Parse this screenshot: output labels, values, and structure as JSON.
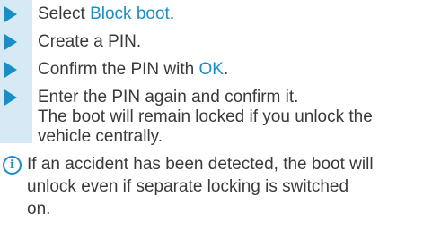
{
  "steps": [
    {
      "prefix": "Select ",
      "highlight": "Block boot",
      "suffix": "."
    },
    {
      "prefix": "Create a PIN.",
      "highlight": "",
      "suffix": ""
    },
    {
      "prefix": "Confirm the PIN with ",
      "highlight": "OK",
      "suffix": "."
    },
    {
      "lines": [
        "Enter the PIN again and confirm it.",
        "The boot will remain locked if you unlock the",
        "vehicle centrally."
      ]
    }
  ],
  "info_note": {
    "icon": "info-icon",
    "lines": [
      "If an accident has been detected, the boot will",
      "unlock even if separate locking is switched",
      "on."
    ]
  },
  "colors": {
    "accent": "#1a8ec4",
    "bar": "#d7e9f4",
    "text": "#3a3a3a"
  }
}
